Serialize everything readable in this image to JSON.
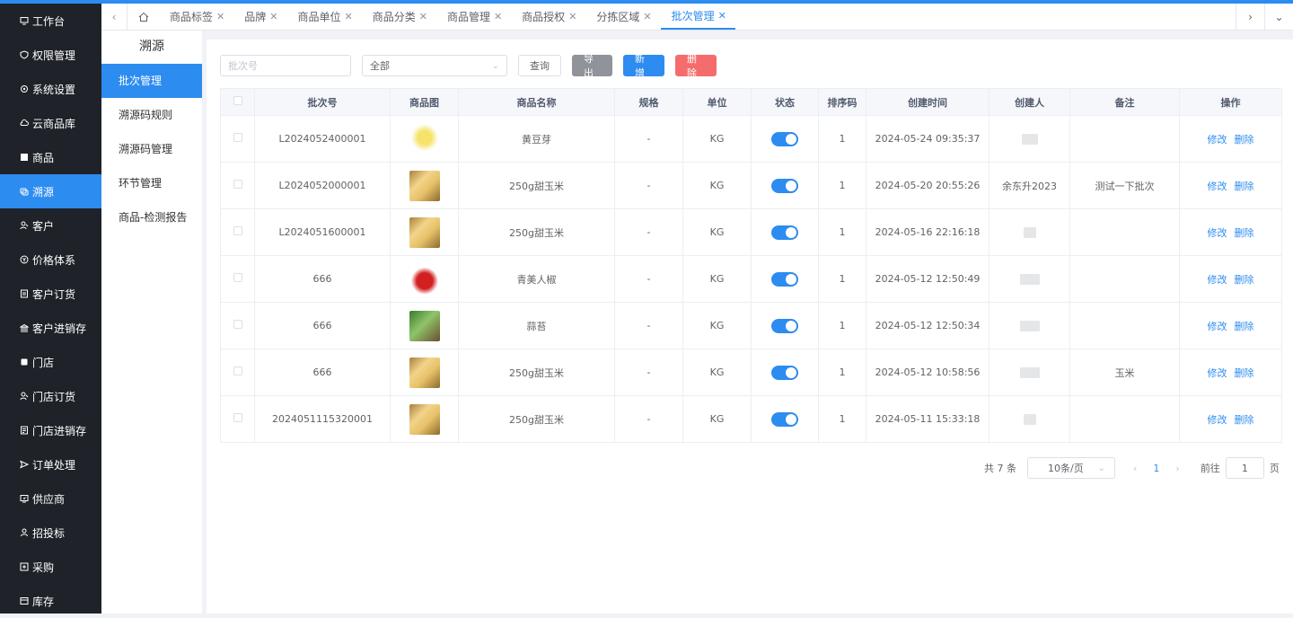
{
  "sidebar": {
    "items": [
      {
        "label": "工作台",
        "icon": "monitor-icon"
      },
      {
        "label": "权限管理",
        "icon": "shield-icon"
      },
      {
        "label": "系统设置",
        "icon": "gear-icon"
      },
      {
        "label": "云商品库",
        "icon": "cloud-icon"
      },
      {
        "label": "商品",
        "icon": "box-icon"
      },
      {
        "label": "溯源",
        "icon": "trace-icon",
        "active": true
      },
      {
        "label": "客户",
        "icon": "user-icon"
      },
      {
        "label": "价格体系",
        "icon": "price-icon"
      },
      {
        "label": "客户订货",
        "icon": "order-icon"
      },
      {
        "label": "客户进销存",
        "icon": "bank-icon"
      },
      {
        "label": "门店",
        "icon": "store-icon"
      },
      {
        "label": "门店订货",
        "icon": "user-icon"
      },
      {
        "label": "门店进销存",
        "icon": "inventory-icon"
      },
      {
        "label": "订单处理",
        "icon": "send-icon"
      },
      {
        "label": "供应商",
        "icon": "supplier-icon"
      },
      {
        "label": "招投标",
        "icon": "person-icon"
      },
      {
        "label": "采购",
        "icon": "purchase-icon"
      },
      {
        "label": "库存",
        "icon": "stock-icon"
      }
    ]
  },
  "tabs": [
    {
      "label": "商品标签"
    },
    {
      "label": "品牌"
    },
    {
      "label": "商品单位"
    },
    {
      "label": "商品分类"
    },
    {
      "label": "商品管理"
    },
    {
      "label": "商品授权"
    },
    {
      "label": "分拣区域"
    },
    {
      "label": "批次管理",
      "active": true
    }
  ],
  "submenu": {
    "title": "溯源",
    "items": [
      "批次管理",
      "溯源码规则",
      "溯源码管理",
      "环节管理",
      "商品-检测报告"
    ]
  },
  "toolbar": {
    "batch_placeholder": "批次号",
    "status_select": "全部",
    "query": "查询",
    "export": "导出",
    "add": "新增",
    "delete": "删除"
  },
  "table": {
    "headers": [
      "批次号",
      "商品图",
      "商品名称",
      "规格",
      "单位",
      "状态",
      "排序码",
      "创建时间",
      "创建人",
      "备注",
      "操作"
    ],
    "rows": [
      {
        "batch": "L2024052400001",
        "img": "sprout",
        "name": "黄豆芽",
        "spec": "-",
        "unit": "KG",
        "sort": "1",
        "created": "2024-05-24 09:35:37",
        "creator": "",
        "note": ""
      },
      {
        "batch": "L2024052000001",
        "img": "corn",
        "name": "250g甜玉米",
        "spec": "-",
        "unit": "KG",
        "sort": "1",
        "created": "2024-05-20 20:55:26",
        "creator": "余东升2023",
        "note": "测试一下批次"
      },
      {
        "batch": "L2024051600001",
        "img": "corn",
        "name": "250g甜玉米",
        "spec": "-",
        "unit": "KG",
        "sort": "1",
        "created": "2024-05-16 22:16:18",
        "creator": "",
        "note": ""
      },
      {
        "batch": "666",
        "img": "pepper",
        "name": "青美人椒",
        "spec": "-",
        "unit": "KG",
        "sort": "1",
        "created": "2024-05-12 12:50:49",
        "creator": "",
        "note": ""
      },
      {
        "batch": "666",
        "img": "garlic",
        "name": "蒜苔",
        "spec": "-",
        "unit": "KG",
        "sort": "1",
        "created": "2024-05-12 12:50:34",
        "creator": "",
        "note": ""
      },
      {
        "batch": "666",
        "img": "corn",
        "name": "250g甜玉米",
        "spec": "-",
        "unit": "KG",
        "sort": "1",
        "created": "2024-05-12 10:58:56",
        "creator": "",
        "note": "玉米"
      },
      {
        "batch": "2024051115320001",
        "img": "corn",
        "name": "250g甜玉米",
        "spec": "-",
        "unit": "KG",
        "sort": "1",
        "created": "2024-05-11 15:33:18",
        "creator": "",
        "note": ""
      }
    ],
    "action_edit": "修改",
    "action_delete": "删除"
  },
  "pagination": {
    "total": "共 7 条",
    "page_size": "10条/页",
    "current_page": "1",
    "goto_label": "前往",
    "goto_value": "1",
    "goto_unit": "页"
  },
  "colors": {
    "accent": "#2d8cf0",
    "danger": "#f56c6c",
    "sidebar_bg": "#1f2329"
  }
}
